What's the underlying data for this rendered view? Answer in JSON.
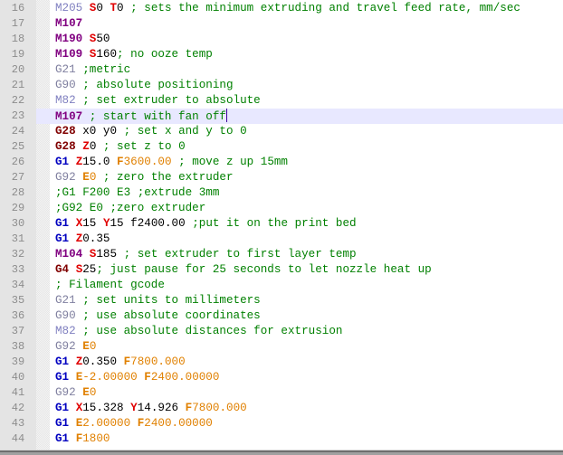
{
  "editor": {
    "language": "G-code",
    "current_line": 23,
    "caret_after_text": "M107 ; start with fan off",
    "colors": {
      "current_line_bg": "#e8e8ff",
      "gutter_bg": "#e4e4e4",
      "mcode": "#800080",
      "gcode_g1": "#0000c0",
      "gcode_dark": "#800000",
      "gcode_light": "#8080a0",
      "axis_letter": "#e00000",
      "e_f_param": "#e08000",
      "comment": "#008000"
    },
    "lines": [
      {
        "n": "16",
        "tokens": [
          [
            "t-mcode-lite",
            "M205"
          ],
          [
            "t-plain",
            " "
          ],
          [
            "t-axis",
            "S"
          ],
          [
            "t-num",
            "0"
          ],
          [
            "t-plain",
            " "
          ],
          [
            "t-axis",
            "T"
          ],
          [
            "t-num",
            "0"
          ],
          [
            "t-comment",
            " ; sets the minimum extruding and travel feed rate, mm/sec"
          ]
        ]
      },
      {
        "n": "17",
        "tokens": [
          [
            "t-mcode",
            "M107"
          ]
        ]
      },
      {
        "n": "18",
        "tokens": [
          [
            "t-mcode",
            "M190"
          ],
          [
            "t-plain",
            " "
          ],
          [
            "t-axis",
            "S"
          ],
          [
            "t-num",
            "50"
          ]
        ]
      },
      {
        "n": "19",
        "tokens": [
          [
            "t-mcode",
            "M109"
          ],
          [
            "t-plain",
            " "
          ],
          [
            "t-axis",
            "S"
          ],
          [
            "t-num",
            "160"
          ],
          [
            "t-comment",
            "; no ooze temp"
          ]
        ]
      },
      {
        "n": "20",
        "tokens": [
          [
            "t-glite",
            "G21"
          ],
          [
            "t-comment",
            " ;metric"
          ]
        ]
      },
      {
        "n": "21",
        "tokens": [
          [
            "t-glite",
            "G90"
          ],
          [
            "t-comment",
            " ; absolute positioning"
          ]
        ]
      },
      {
        "n": "22",
        "tokens": [
          [
            "t-mcode-lite",
            "M82"
          ],
          [
            "t-comment",
            " ; set extruder to absolute"
          ]
        ]
      },
      {
        "n": "23",
        "tokens": [
          [
            "t-mcode",
            "M107"
          ],
          [
            "t-comment",
            " ; start with fan off"
          ]
        ],
        "current": true
      },
      {
        "n": "24",
        "tokens": [
          [
            "t-gdark",
            "G28"
          ],
          [
            "t-plain",
            " x0 y0"
          ],
          [
            "t-comment",
            " ; set x and y to 0"
          ]
        ]
      },
      {
        "n": "25",
        "tokens": [
          [
            "t-gdark",
            "G28"
          ],
          [
            "t-plain",
            " "
          ],
          [
            "t-axis",
            "Z"
          ],
          [
            "t-num",
            "0"
          ],
          [
            "t-comment",
            " ; set z to 0"
          ]
        ]
      },
      {
        "n": "26",
        "tokens": [
          [
            "t-g1",
            "G1"
          ],
          [
            "t-plain",
            " "
          ],
          [
            "t-axis",
            "Z"
          ],
          [
            "t-num",
            "15.0"
          ],
          [
            "t-plain",
            " "
          ],
          [
            "t-ef",
            "F"
          ],
          [
            "t-efnum",
            "3600.00"
          ],
          [
            "t-comment",
            " ; move z up 15mm"
          ]
        ]
      },
      {
        "n": "27",
        "tokens": [
          [
            "t-glite",
            "G92"
          ],
          [
            "t-plain",
            " "
          ],
          [
            "t-ef",
            "E"
          ],
          [
            "t-efnum",
            "0"
          ],
          [
            "t-comment",
            " ; zero the extruder"
          ]
        ]
      },
      {
        "n": "28",
        "tokens": [
          [
            "t-comment",
            ";G1 F200 E3 ;extrude 3mm"
          ]
        ]
      },
      {
        "n": "29",
        "tokens": [
          [
            "t-comment",
            ";G92 E0 ;zero extruder"
          ]
        ]
      },
      {
        "n": "30",
        "tokens": [
          [
            "t-g1",
            "G1"
          ],
          [
            "t-plain",
            " "
          ],
          [
            "t-axis",
            "X"
          ],
          [
            "t-num",
            "15"
          ],
          [
            "t-plain",
            " "
          ],
          [
            "t-axis",
            "Y"
          ],
          [
            "t-num",
            "15"
          ],
          [
            "t-plain",
            " f2400.00"
          ],
          [
            "t-comment",
            " ;put it on the print bed"
          ]
        ]
      },
      {
        "n": "31",
        "tokens": [
          [
            "t-g1",
            "G1"
          ],
          [
            "t-plain",
            " "
          ],
          [
            "t-axis",
            "Z"
          ],
          [
            "t-num",
            "0.35"
          ]
        ]
      },
      {
        "n": "32",
        "tokens": [
          [
            "t-mcode",
            "M104"
          ],
          [
            "t-plain",
            " "
          ],
          [
            "t-axis",
            "S"
          ],
          [
            "t-num",
            "185"
          ],
          [
            "t-comment",
            " ; set extruder to first layer temp"
          ]
        ]
      },
      {
        "n": "33",
        "tokens": [
          [
            "t-gdark",
            "G4"
          ],
          [
            "t-plain",
            " "
          ],
          [
            "t-axis",
            "S"
          ],
          [
            "t-num",
            "25"
          ],
          [
            "t-comment",
            "; just pause for 25 seconds to let nozzle heat up"
          ]
        ]
      },
      {
        "n": "34",
        "tokens": [
          [
            "t-comment",
            "; Filament gcode"
          ]
        ]
      },
      {
        "n": "35",
        "tokens": [
          [
            "t-glite",
            "G21"
          ],
          [
            "t-comment",
            " ; set units to millimeters"
          ]
        ]
      },
      {
        "n": "36",
        "tokens": [
          [
            "t-glite",
            "G90"
          ],
          [
            "t-comment",
            " ; use absolute coordinates"
          ]
        ]
      },
      {
        "n": "37",
        "tokens": [
          [
            "t-mcode-lite",
            "M82"
          ],
          [
            "t-comment",
            " ; use absolute distances for extrusion"
          ]
        ]
      },
      {
        "n": "38",
        "tokens": [
          [
            "t-glite",
            "G92"
          ],
          [
            "t-plain",
            " "
          ],
          [
            "t-ef",
            "E"
          ],
          [
            "t-efnum",
            "0"
          ]
        ]
      },
      {
        "n": "39",
        "tokens": [
          [
            "t-g1",
            "G1"
          ],
          [
            "t-plain",
            " "
          ],
          [
            "t-axis",
            "Z"
          ],
          [
            "t-num",
            "0.350"
          ],
          [
            "t-plain",
            " "
          ],
          [
            "t-ef",
            "F"
          ],
          [
            "t-efnum",
            "7800.000"
          ]
        ]
      },
      {
        "n": "40",
        "tokens": [
          [
            "t-g1",
            "G1"
          ],
          [
            "t-plain",
            " "
          ],
          [
            "t-ef",
            "E"
          ],
          [
            "t-efnum",
            "-2.00000"
          ],
          [
            "t-plain",
            " "
          ],
          [
            "t-ef",
            "F"
          ],
          [
            "t-efnum",
            "2400.00000"
          ]
        ]
      },
      {
        "n": "41",
        "tokens": [
          [
            "t-glite",
            "G92"
          ],
          [
            "t-plain",
            " "
          ],
          [
            "t-ef",
            "E"
          ],
          [
            "t-efnum",
            "0"
          ]
        ]
      },
      {
        "n": "42",
        "tokens": [
          [
            "t-g1",
            "G1"
          ],
          [
            "t-plain",
            " "
          ],
          [
            "t-axis",
            "X"
          ],
          [
            "t-num",
            "15.328"
          ],
          [
            "t-plain",
            " "
          ],
          [
            "t-axis",
            "Y"
          ],
          [
            "t-num",
            "14.926"
          ],
          [
            "t-plain",
            " "
          ],
          [
            "t-ef",
            "F"
          ],
          [
            "t-efnum",
            "7800.000"
          ]
        ]
      },
      {
        "n": "43",
        "tokens": [
          [
            "t-g1",
            "G1"
          ],
          [
            "t-plain",
            " "
          ],
          [
            "t-ef",
            "E"
          ],
          [
            "t-efnum",
            "2.00000"
          ],
          [
            "t-plain",
            " "
          ],
          [
            "t-ef",
            "F"
          ],
          [
            "t-efnum",
            "2400.00000"
          ]
        ]
      },
      {
        "n": "44",
        "tokens": [
          [
            "t-g1",
            "G1"
          ],
          [
            "t-plain",
            " "
          ],
          [
            "t-ef",
            "F"
          ],
          [
            "t-efnum",
            "1800"
          ]
        ]
      }
    ]
  }
}
